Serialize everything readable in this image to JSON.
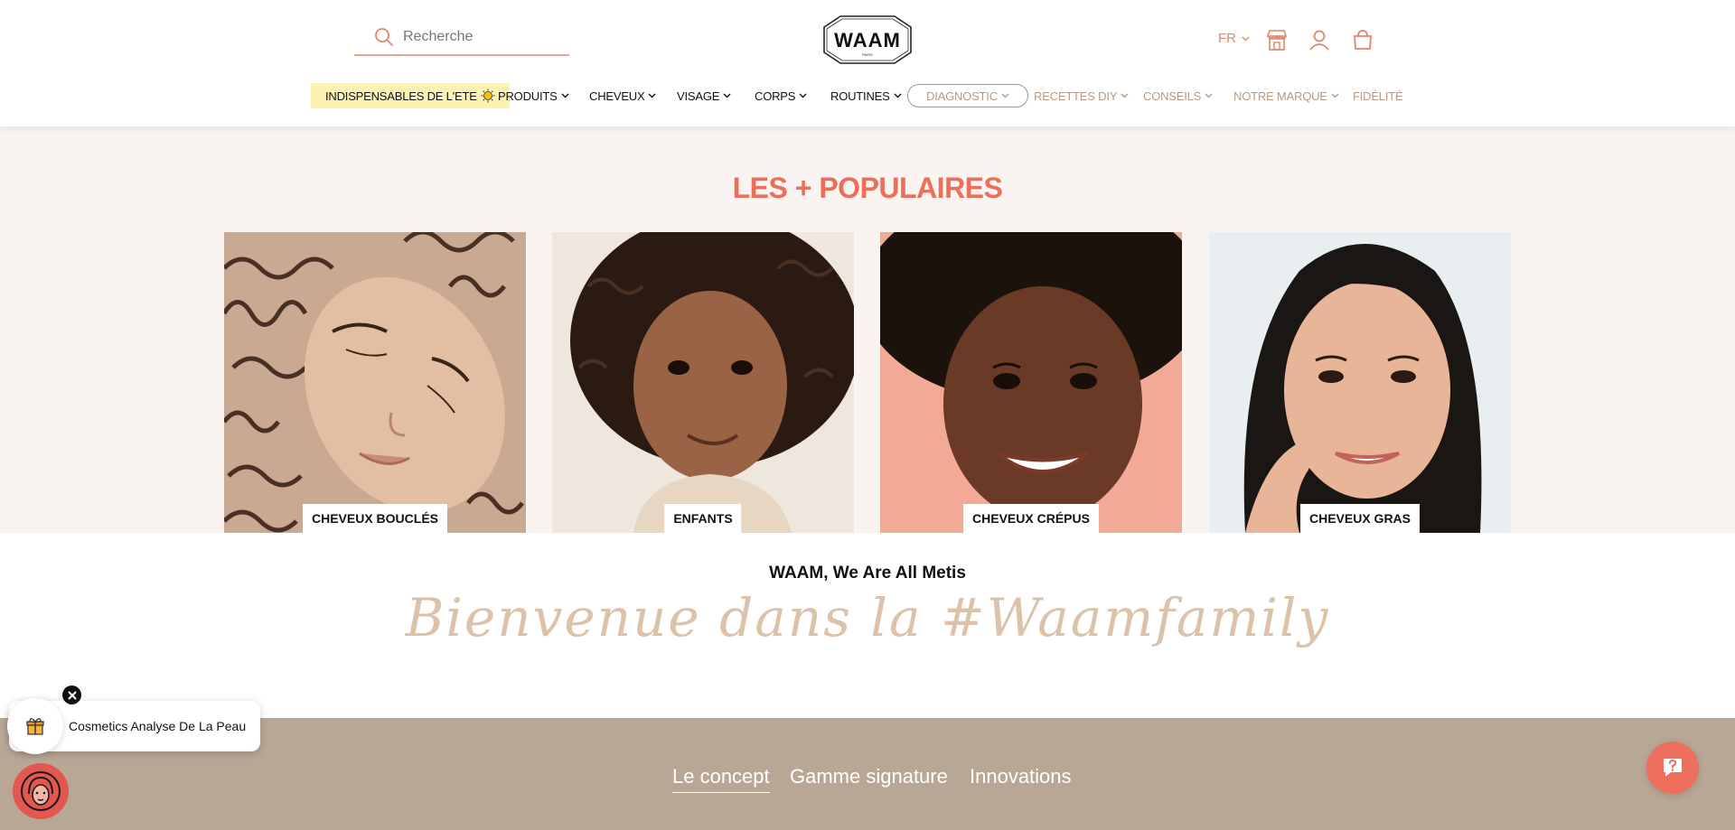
{
  "header": {
    "search_placeholder": "Recherche",
    "logo_text": "WAAM",
    "logo_sub": "PARIS",
    "lang": "FR"
  },
  "nav": {
    "items": [
      {
        "label": "INDISPENSABLES DE L'ETE"
      },
      {
        "label": "PRODUITS"
      },
      {
        "label": "CHEVEUX"
      },
      {
        "label": "VISAGE"
      },
      {
        "label": "CORPS"
      },
      {
        "label": "ROUTINES"
      },
      {
        "label": "DIAGNOSTIC"
      },
      {
        "label": "RECETTES DIY"
      },
      {
        "label": "CONSEILS"
      },
      {
        "label": "NOTRE MARQUE"
      },
      {
        "label": "FIDÉLITÉ"
      }
    ]
  },
  "populaires": {
    "title": "LES + POPULAIRES",
    "cards": [
      {
        "label": "CHEVEUX BOUCLÉS"
      },
      {
        "label": "ENFANTS"
      },
      {
        "label": "CHEVEUX CRÉPUS"
      },
      {
        "label": "CHEVEUX GRAS"
      }
    ]
  },
  "family": {
    "heading": "WAAM, We Are All Metis",
    "script": "Bienvenue dans la #Waamfamily"
  },
  "band": {
    "tabs": [
      {
        "label": "Le concept"
      },
      {
        "label": "Gamme signature"
      },
      {
        "label": "Innovations"
      }
    ]
  },
  "widgets": {
    "gift_text": "Cosmetics Analyse De La Peau"
  },
  "colors": {
    "accent": "#ee6f59",
    "beige_band": "#b9a796",
    "section_bg": "#f9f4f1",
    "script": "#dcc2a9"
  }
}
